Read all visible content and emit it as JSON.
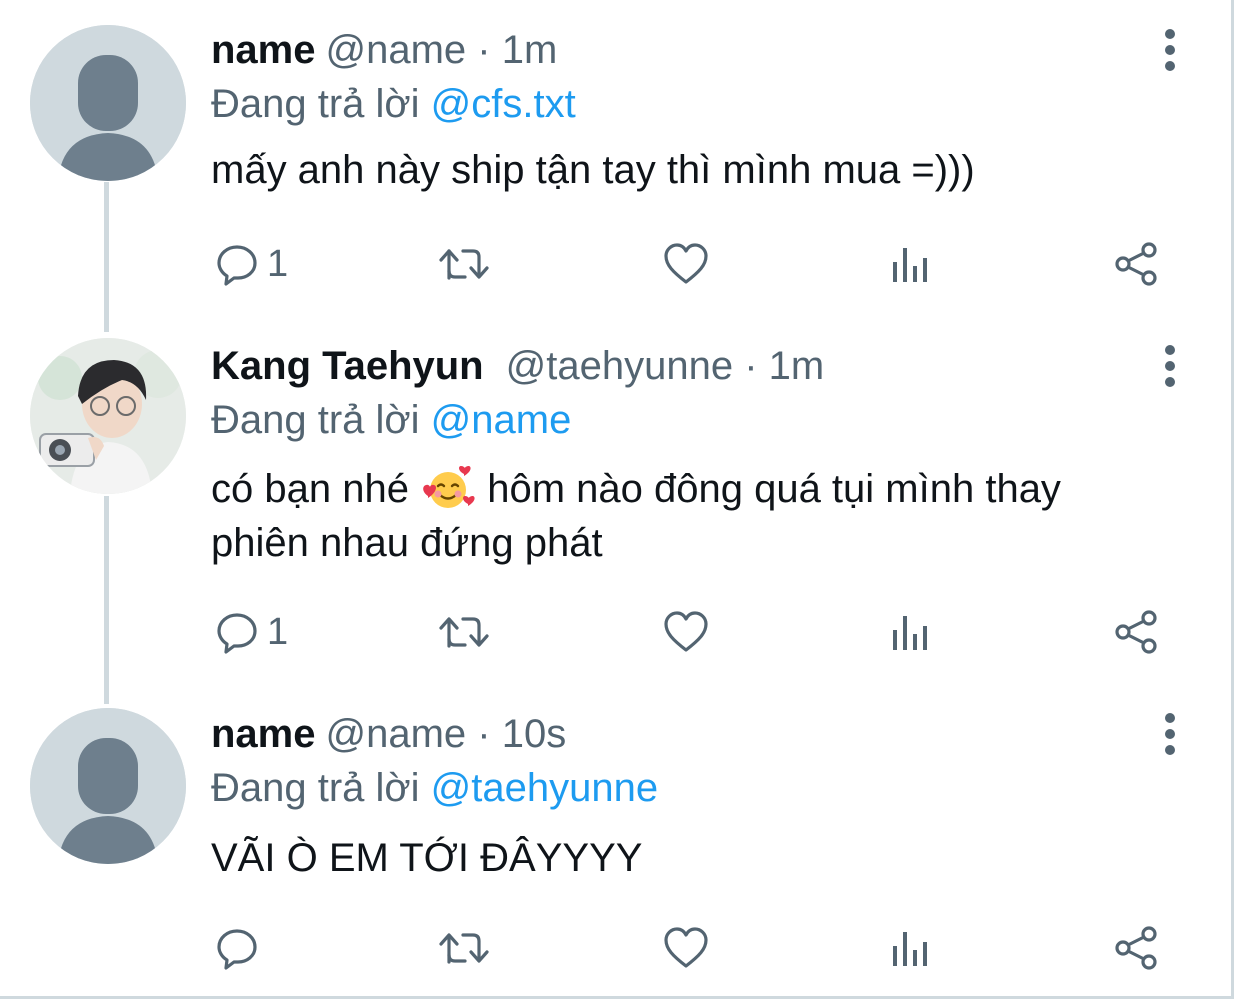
{
  "tweets": [
    {
      "display_name": "name",
      "handle": "@name",
      "separator": "·",
      "time": "1m",
      "replying_label": "Đang trả lời",
      "replying_to": "@cfs.txt",
      "text": "mấy anh này ship tận tay thì mình mua =)))",
      "reply_count": "1",
      "avatar": "default-avatar"
    },
    {
      "display_name": "Kang Taehyun",
      "handle": "@taehyunne",
      "separator": "·",
      "time": "1m",
      "replying_label": "Đang trả lời",
      "replying_to": "@name",
      "text_before_emoji": "có bạn nhé",
      "emoji": "smiling-face-with-hearts-emoji",
      "text_after_emoji": "hôm nào đông quá tụi mình thay phiên nhau đứng phát",
      "reply_count": "1",
      "avatar": "photo-avatar"
    },
    {
      "display_name": "name",
      "handle": "@name",
      "separator": "·",
      "time": "10s",
      "replying_label": "Đang trả lời",
      "replying_to": "@taehyunne",
      "text": "VÃI Ò EM TỚI ĐÂYYYY",
      "reply_count": "",
      "avatar": "default-avatar"
    }
  ],
  "icons": {
    "reply": "reply-icon",
    "retweet": "retweet-icon",
    "like": "like-icon",
    "analytics": "analytics-icon",
    "share": "share-icon",
    "more": "more-options-icon"
  },
  "colors": {
    "text": "#0f1419",
    "secondary": "#536471",
    "link": "#1d9bf0",
    "avatar_bg": "#cfd9de",
    "avatar_figure": "#6e7f8d",
    "thread_line": "#cfd9de"
  }
}
